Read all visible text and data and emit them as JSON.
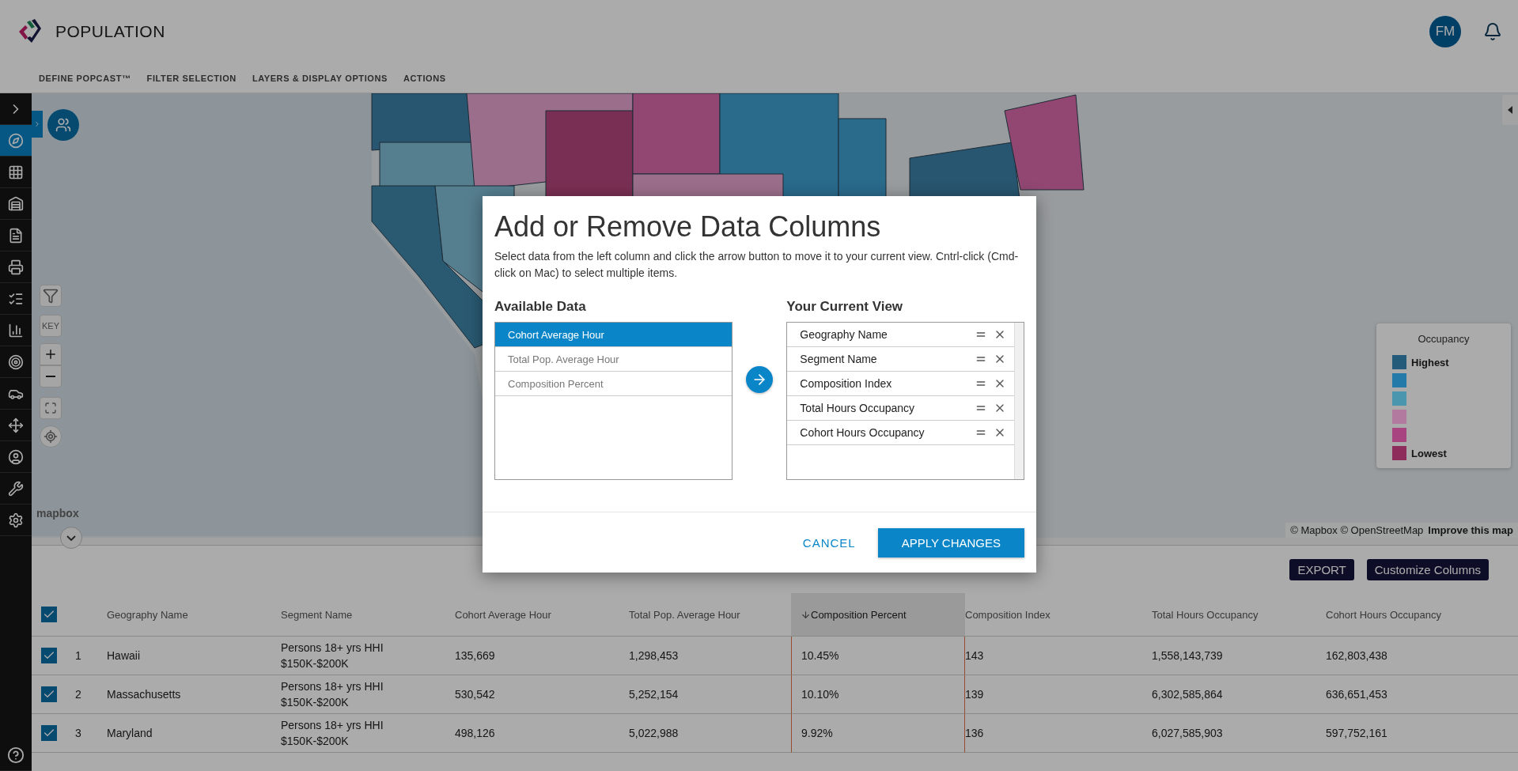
{
  "header": {
    "title": "POPULATION",
    "avatar": "FM"
  },
  "nav": [
    "DEFINE POPCAST™",
    "FILTER SELECTION",
    "LAYERS & DISPLAY OPTIONS",
    "ACTIONS"
  ],
  "sidebar": {
    "items": [
      {
        "selected": false
      },
      {
        "selected": true
      },
      {
        "selected": false
      },
      {
        "selected": false
      },
      {
        "selected": false
      },
      {
        "selected": false
      },
      {
        "selected": false
      },
      {
        "selected": false
      },
      {
        "selected": false
      },
      {
        "selected": false
      },
      {
        "selected": false
      },
      {
        "selected": false
      },
      {
        "selected": false
      },
      {
        "selected": false
      }
    ]
  },
  "map": {
    "kind": "picture",
    "key_label": "KEY",
    "logo_text": "mapbox",
    "attribution": "© Mapbox © OpenStreetMap",
    "improve_link": "Improve this map",
    "legend": {
      "title": "Occupancy",
      "items": [
        {
          "label": "Highest",
          "color": "#245a7a"
        },
        {
          "color": "#247aa8"
        },
        {
          "color": "#4a96ae"
        },
        {
          "color": "#b27a9e"
        },
        {
          "color": "#a8447f"
        },
        {
          "label": "Lowest",
          "color": "#8e2c5c"
        }
      ]
    }
  },
  "table": {
    "buttons": [
      "EXPORT",
      "Customize Columns"
    ],
    "all_checked": true,
    "columns": [
      {
        "label": "Geography Name",
        "sorted": false
      },
      {
        "label": "Segment Name",
        "sorted": false
      },
      {
        "label": "Cohort Average Hour",
        "sorted": false
      },
      {
        "label": "Total Pop. Average Hour",
        "sorted": false
      },
      {
        "label": "Composition Percent",
        "sorted": true
      },
      {
        "label": "Composition Index",
        "sorted": false
      },
      {
        "label": "Total Hours Occupancy",
        "sorted": false
      },
      {
        "label": "Cohort Hours Occupancy",
        "sorted": false
      }
    ],
    "rows": [
      {
        "checked": true,
        "number": "1",
        "cells": [
          "Hawaii",
          "Persons 18+ yrs HHI $150K-$200K",
          "135,669",
          "1,298,453",
          "10.45%",
          "143",
          "1,558,143,739",
          "162,803,438"
        ]
      },
      {
        "checked": true,
        "number": "2",
        "cells": [
          "Massachusetts",
          "Persons 18+ yrs HHI $150K-$200K",
          "530,542",
          "5,252,154",
          "10.10%",
          "139",
          "6,302,585,864",
          "636,651,453"
        ]
      },
      {
        "checked": true,
        "number": "3",
        "cells": [
          "Maryland",
          "Persons 18+ yrs HHI $150K-$200K",
          "498,126",
          "5,022,988",
          "9.92%",
          "136",
          "6,027,585,903",
          "597,752,161"
        ]
      }
    ]
  },
  "modal": {
    "title": "Add or Remove Data Columns",
    "description": "Select data from the left column and click the arrow button to move it to your current view. Cntrl-click (Cmd-click on Mac) to select multiple items.",
    "available": {
      "title": "Available Data",
      "items": [
        {
          "label": "Cohort Average Hour",
          "selected": true
        },
        {
          "label": "Total Pop. Average Hour",
          "selected": false
        },
        {
          "label": "Composition Percent",
          "selected": false
        }
      ]
    },
    "current": {
      "title": "Your Current View",
      "items": [
        "Geography Name",
        "Segment Name",
        "Composition Index",
        "Total Hours Occupancy",
        "Cohort Hours Occupancy"
      ]
    },
    "cancel": "CANCEL",
    "apply": "APPLY CHANGES"
  }
}
